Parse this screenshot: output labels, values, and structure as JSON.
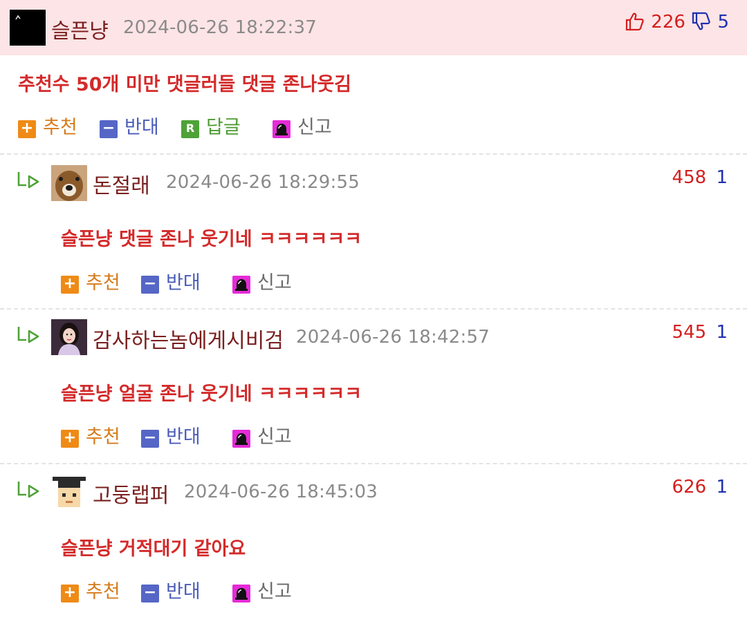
{
  "top_comment": {
    "nickname": "슬픈냥",
    "date": "2024-06-26 18:22:37",
    "upvotes": "226",
    "downvotes": "5",
    "text": "추천수 50개 미만 댓글러들 댓글 존나웃김",
    "actions": {
      "recommend": "추천",
      "oppose": "반대",
      "reply": "답글",
      "report": "신고"
    }
  },
  "replies": [
    {
      "nickname": "돈절래",
      "date": "2024-06-26 18:29:55",
      "upvotes": "458",
      "downvotes": "1",
      "text": "슬픈냥 댓글 존나 웃기네 ㅋㅋㅋㅋㅋㅋ",
      "actions": {
        "recommend": "추천",
        "oppose": "반대",
        "report": "신고"
      }
    },
    {
      "nickname": "감사하는놈에게시비검",
      "date": "2024-06-26 18:42:57",
      "upvotes": "545",
      "downvotes": "1",
      "text": "슬픈냥 얼굴 존나 웃기네 ㅋㅋㅋㅋㅋㅋ",
      "actions": {
        "recommend": "추천",
        "oppose": "반대",
        "report": "신고"
      }
    },
    {
      "nickname": "고둥랩퍼",
      "date": "2024-06-26 18:45:03",
      "upvotes": "626",
      "downvotes": "1",
      "text": "슬픈냥 거적대기 같아요",
      "actions": {
        "recommend": "추천",
        "oppose": "반대",
        "report": "신고"
      }
    }
  ],
  "colors": {
    "header_bg": "#fde4e6",
    "nickname": "#7a1f1f",
    "comment_text": "#d42a2a",
    "upvote": "#d41e1e",
    "downvote": "#1f2fb0",
    "recommend": "#ef8a16",
    "oppose": "#5566c6",
    "reply": "#4ea238",
    "report": "#e52bd7"
  },
  "icons": {
    "upvote": "thumbs-up-icon",
    "downvote": "thumbs-down-icon",
    "recommend": "plus-icon",
    "oppose": "minus-icon",
    "reply": "reply-r-icon",
    "report": "siren-icon",
    "reply_marker": "reply-arrow-icon"
  }
}
